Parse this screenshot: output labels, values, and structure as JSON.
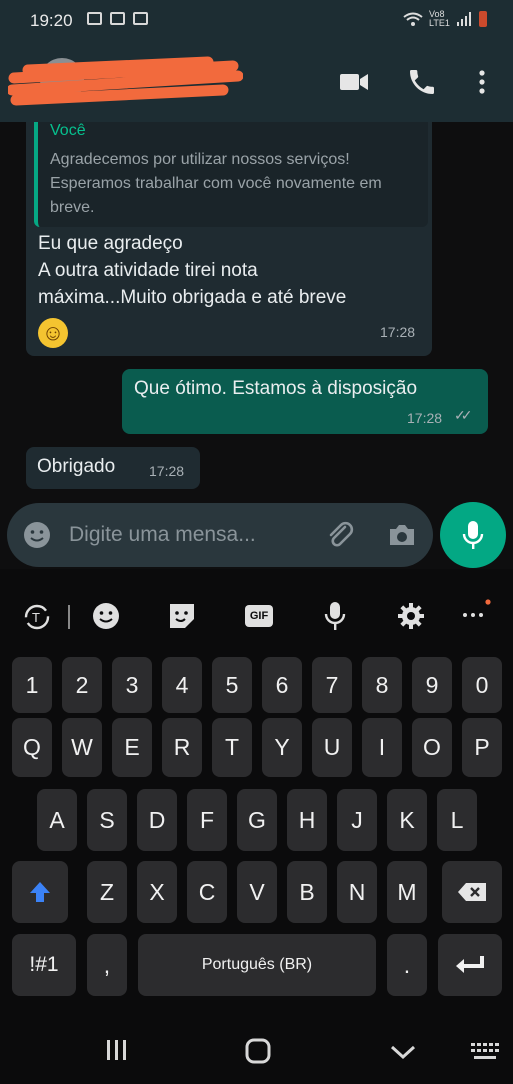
{
  "status_bar": {
    "time": "19:20",
    "network": "Vo8 LTE1"
  },
  "chat": {
    "quoted": {
      "author": "Você",
      "text": "Agradecemos por utilizar nossos serviços! Esperamos trabalhar com você novamente em breve."
    },
    "messages": [
      {
        "direction": "in",
        "lines": [
          "Eu que agradeço",
          "A outra atividade tirei nota",
          "máxima...Muito obrigada e até  breve"
        ],
        "emoji": "☺",
        "time": "17:28"
      },
      {
        "direction": "out",
        "text": "Que ótimo. Estamos à disposição",
        "time": "17:28",
        "ticks": "✓✓"
      },
      {
        "direction": "in",
        "text": "Obrigado",
        "time": "17:28"
      }
    ]
  },
  "input": {
    "placeholder": "Digite uma mensa..."
  },
  "keyboard": {
    "gif_label": "GIF",
    "row_numbers": [
      "1",
      "2",
      "3",
      "4",
      "5",
      "6",
      "7",
      "8",
      "9",
      "0"
    ],
    "row1": [
      "Q",
      "W",
      "E",
      "R",
      "T",
      "Y",
      "U",
      "I",
      "O",
      "P"
    ],
    "row2": [
      "A",
      "S",
      "D",
      "F",
      "G",
      "H",
      "J",
      "K",
      "L"
    ],
    "row3": [
      "Z",
      "X",
      "C",
      "V",
      "B",
      "N",
      "M"
    ],
    "symbols_label": "!#1",
    "comma_label": ",",
    "space_label": "Português (BR)",
    "period_label": "."
  },
  "colors": {
    "accent": "#03a884",
    "outgoing_bubble": "#0a5c4f",
    "incoming_bubble": "#1f2b31",
    "header": "#1d2d33"
  }
}
